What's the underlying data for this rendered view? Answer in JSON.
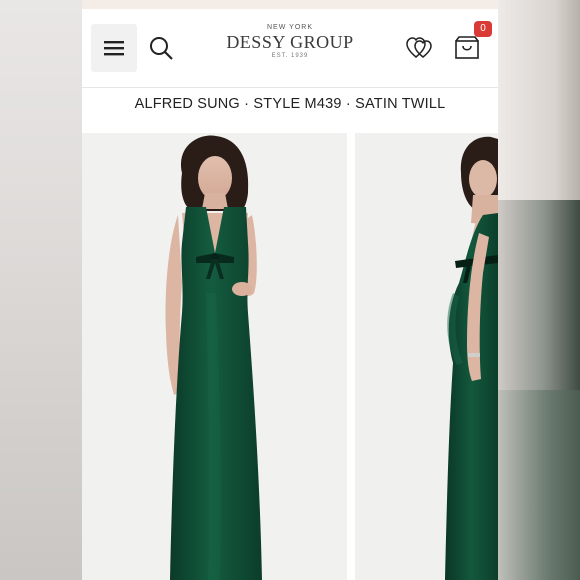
{
  "header": {
    "brand": {
      "top": "NEW YORK",
      "name": "DESSY GROUP",
      "est": "EST. 1939"
    },
    "cart_count": "0",
    "icons": {
      "menu": "hamburger-menu-icon",
      "search": "search-icon",
      "wishlist": "double-heart-icon",
      "cart": "shopping-bag-icon"
    }
  },
  "product": {
    "title": "ALFRED SUNG · STYLE M439 · SATIN TWILL"
  },
  "gallery": {
    "images": [
      {
        "view": "front",
        "dress_color": "#0f4a33"
      },
      {
        "view": "side",
        "dress_color": "#0f4a33"
      }
    ]
  },
  "colors": {
    "dress": "#0f4a33",
    "badge": "#d93a36",
    "image_bg": "#f1f1ef"
  }
}
